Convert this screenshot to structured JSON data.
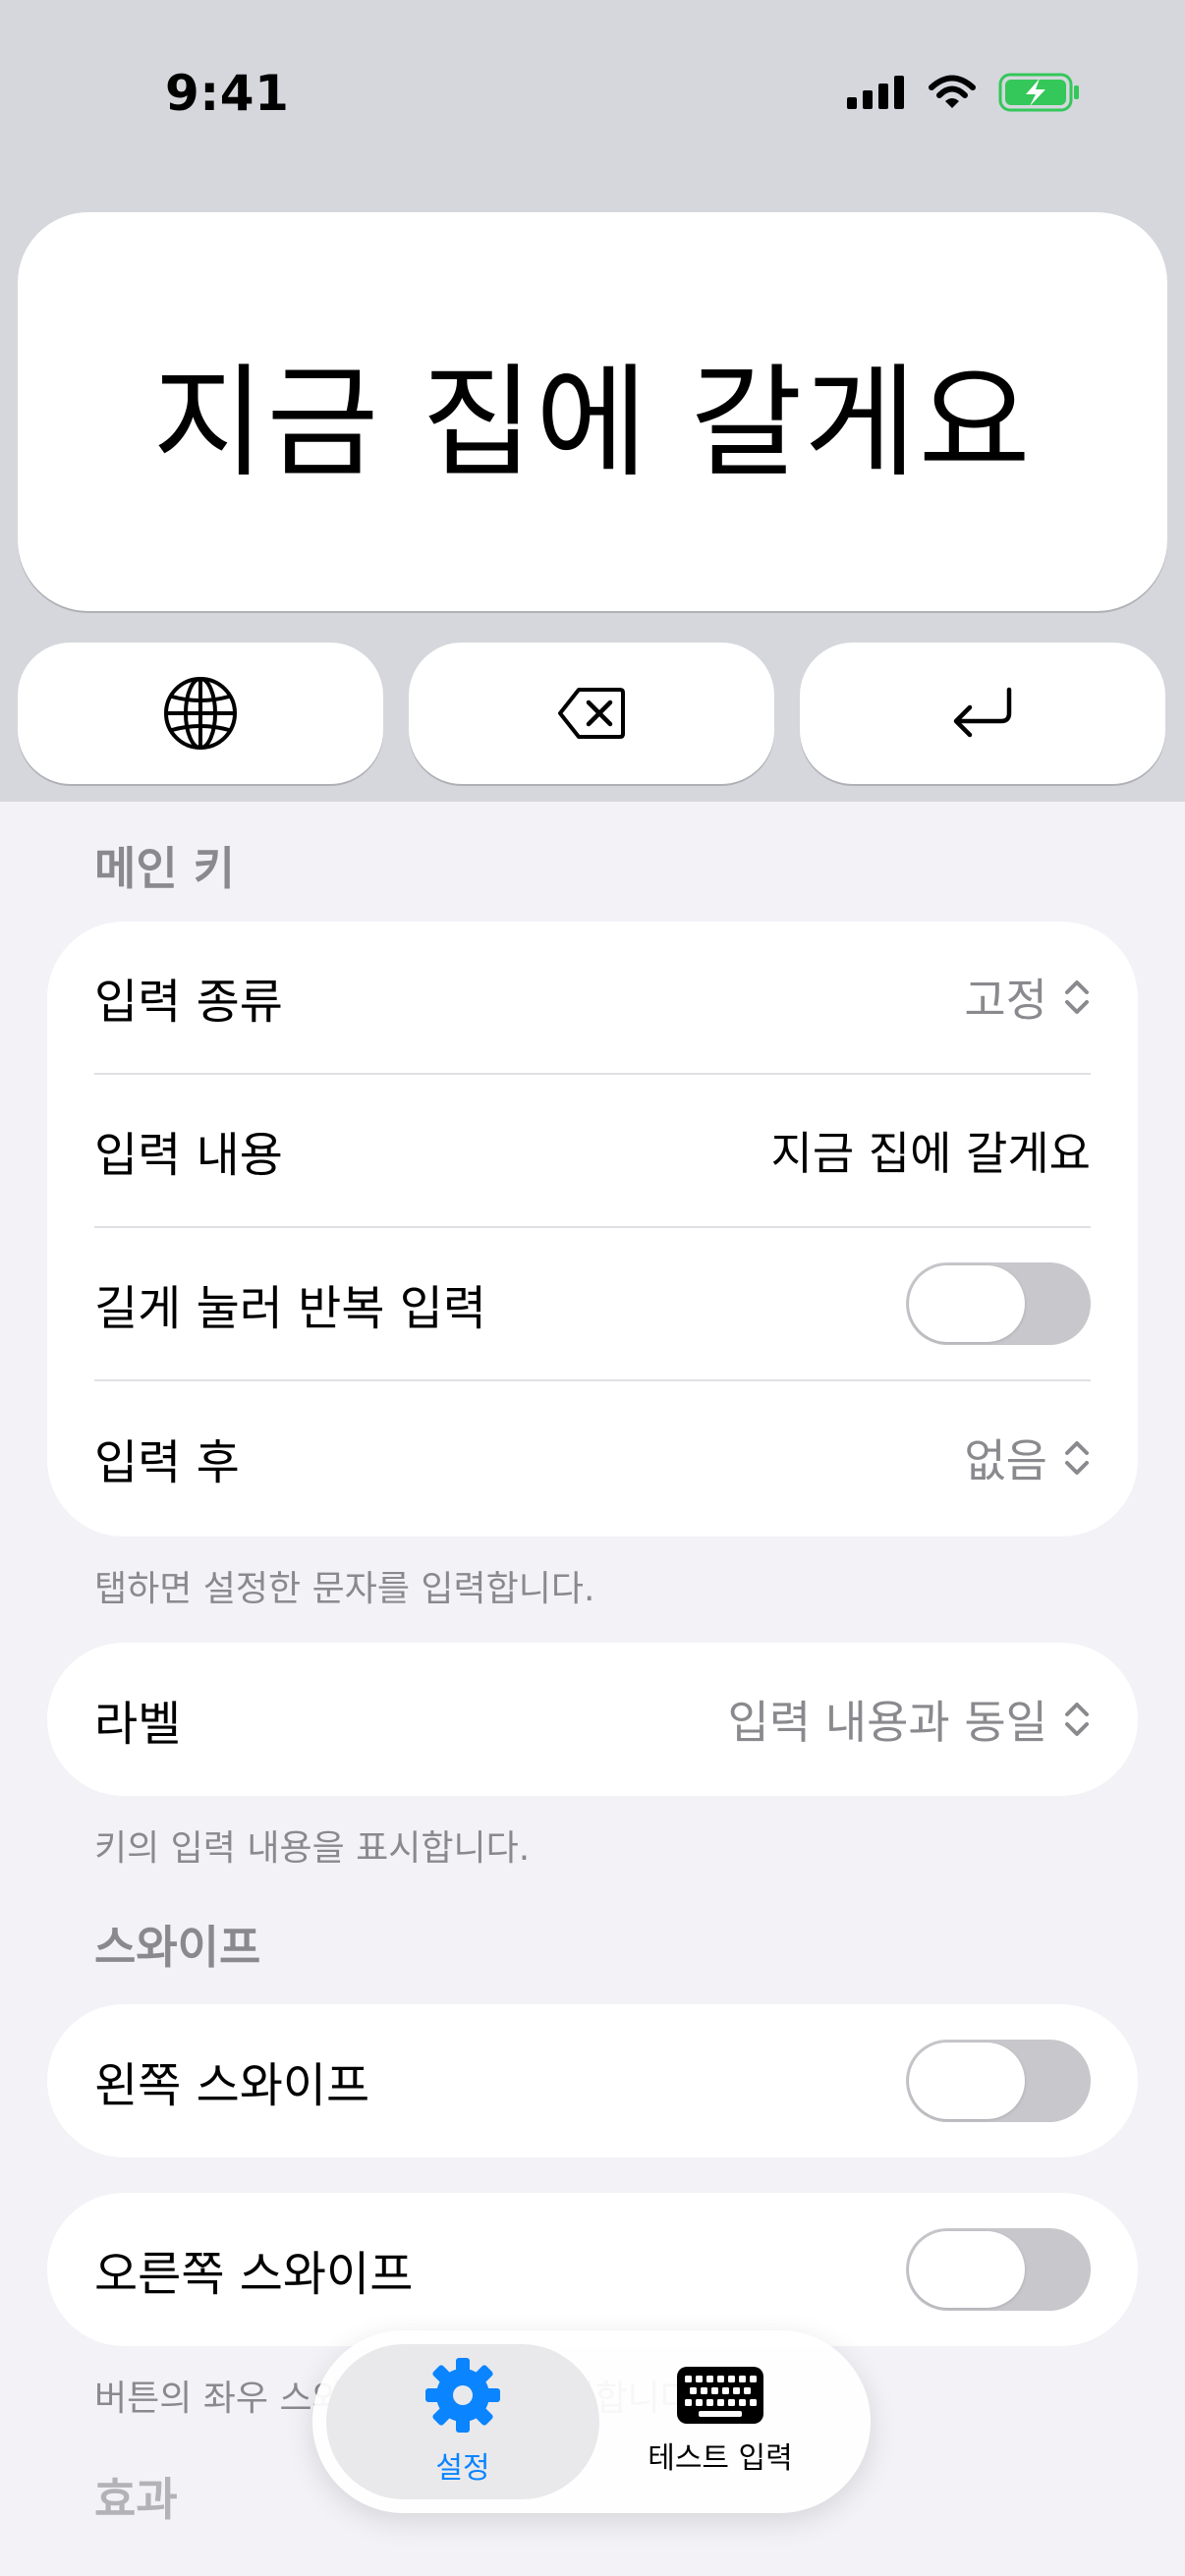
{
  "status_bar": {
    "time": "9:41"
  },
  "keyboard_preview": {
    "main_key_text": "지금 집에 갈게요",
    "globe_icon": "globe-icon",
    "delete_icon": "delete-backward-icon",
    "return_icon": "return-icon"
  },
  "main_key_section": {
    "title": "메인 키",
    "rows": [
      {
        "label": "입력 종류",
        "value": "고정"
      },
      {
        "label": "입력 내용",
        "value": "지금 집에 갈게요"
      },
      {
        "label": "길게 눌러 반복 입력",
        "toggle_on": false
      },
      {
        "label": "입력 후",
        "value": "없음"
      }
    ],
    "footnote": "탭하면 설정한 문자를 입력합니다."
  },
  "label_section": {
    "label": "라벨",
    "value": "입력 내용과 동일",
    "footnote": "키의 입력 내용을 표시합니다."
  },
  "swipe_section": {
    "title": "스와이프",
    "left": {
      "label": "왼쪽 스와이프",
      "toggle_on": false
    },
    "right": {
      "label": "오른쪽 스와이프",
      "toggle_on": false
    },
    "footnote": "버튼의 좌우 스와이프 동작을 설정합니다."
  },
  "effects_section": {
    "title": "효과"
  },
  "tab_bar": {
    "tabs": [
      {
        "label": "설정",
        "icon": "gear-icon",
        "active": true
      },
      {
        "label": "테스트 입력",
        "icon": "keyboard-icon",
        "active": false
      }
    ]
  },
  "colors": {
    "accent": "#0a84ff",
    "battery": "#34c759",
    "toggle_off": "#c7c7cc"
  }
}
